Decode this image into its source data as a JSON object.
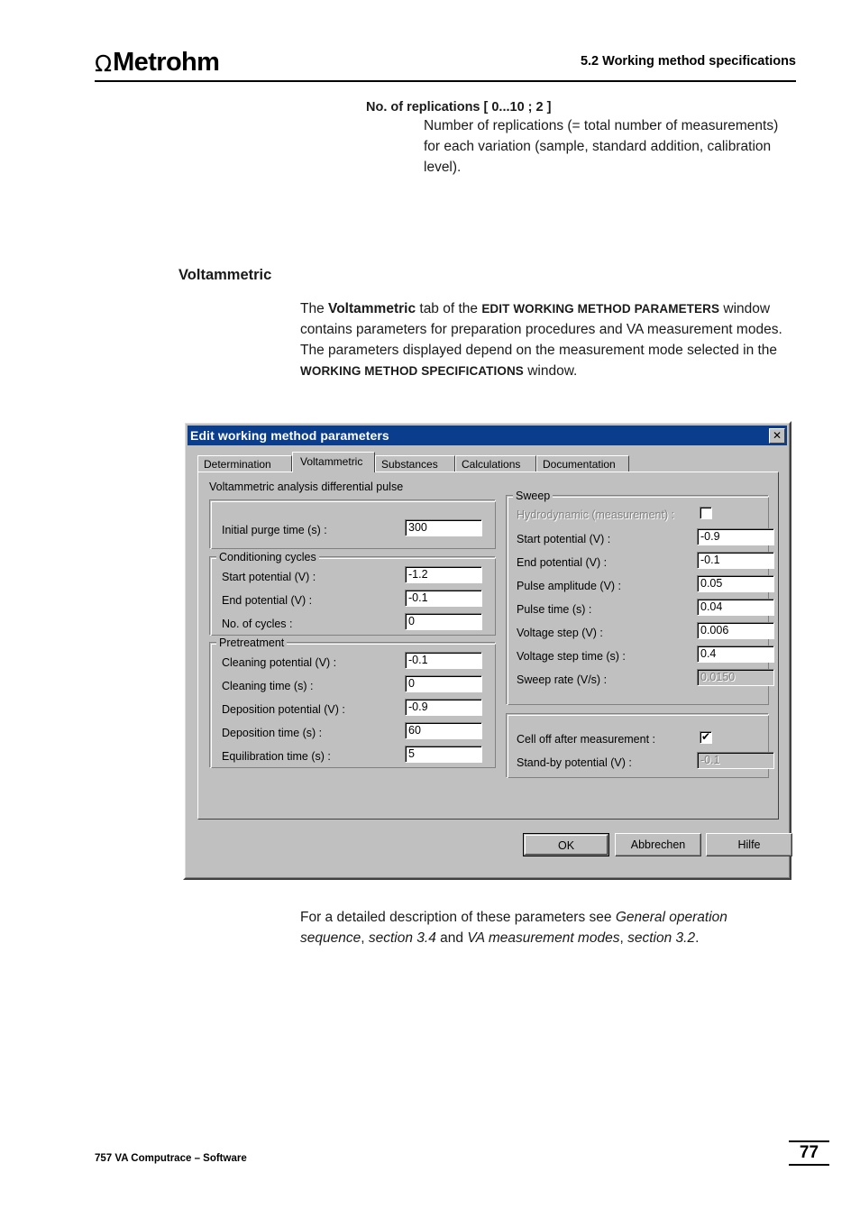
{
  "header": {
    "logo_symbol": "Ω",
    "logo_text": "Metrohm",
    "section_title": "5.2  Working method specifications"
  },
  "content": {
    "replications_term": "No. of replications   [ 0...10 ; 2 ]",
    "replications_desc": "Number of replications (= total number of measurements) for each variation (sample, standard addition, calibration level).",
    "section_heading": "Voltammetric",
    "voltammetric_desc_parts": {
      "p1": "The ",
      "b1": "Voltammetric",
      "p2": " tab of the ",
      "b2": "EDIT WORKING METHOD PARAMETERS",
      "p3": " window contains parameters for preparation procedures and VA measurement modes. The parameters displayed depend on the measurement mode selected in the ",
      "b3": "WORKING METHOD SPECIFICATIONS",
      "p4": " window."
    },
    "footer_note_parts": {
      "p1": "For a detailed description of these parameters see ",
      "i1": "General operation sequence",
      "p2": ", ",
      "i2": "section 3.4",
      "p3": " and ",
      "i3": "VA measurement modes",
      "p4": ", ",
      "i4": "section 3.2",
      "p5": "."
    }
  },
  "dialog": {
    "title": "Edit working method parameters",
    "close_label": "✕",
    "tabs": [
      {
        "label": "Determination",
        "active": false
      },
      {
        "label": "Voltammetric",
        "active": true
      },
      {
        "label": "Substances",
        "active": false
      },
      {
        "label": "Calculations",
        "active": false
      },
      {
        "label": "Documentation",
        "active": false
      }
    ],
    "mode_label": "Voltammetric analysis differential pulse",
    "purge_group": {
      "label": "Initial purge time (s) :",
      "value": "300"
    },
    "conditioning": {
      "title": "Conditioning cycles",
      "rows": [
        {
          "label": "Start potential (V) :",
          "value": "-1.2"
        },
        {
          "label": "End potential (V) :",
          "value": "-0.1"
        },
        {
          "label": "No. of cycles :",
          "value": "0"
        }
      ]
    },
    "pretreatment": {
      "title": "Pretreatment",
      "rows": [
        {
          "label": "Cleaning potential (V) :",
          "value": "-0.1"
        },
        {
          "label": "Cleaning time (s) :",
          "value": "0"
        },
        {
          "label": "Deposition potential (V) :",
          "value": "-0.9"
        },
        {
          "label": "Deposition time (s) :",
          "value": "60"
        },
        {
          "label": "Equilibration time (s) :",
          "value": "5"
        }
      ]
    },
    "sweep": {
      "title": "Sweep",
      "hydrodynamic": {
        "label": "Hydrodynamic (measurement) :",
        "checked": false,
        "disabled": true,
        "mark": ""
      },
      "rows": [
        {
          "label": "Start potential (V) :",
          "value": "-0.9",
          "readonly": false
        },
        {
          "label": "End potential (V) :",
          "value": "-0.1",
          "readonly": false
        },
        {
          "label": "Pulse amplitude (V) :",
          "value": "0.05",
          "readonly": false
        },
        {
          "label": "Pulse time (s) :",
          "value": "0.04",
          "readonly": false
        },
        {
          "label": "Voltage step (V) :",
          "value": "0.006",
          "readonly": false
        },
        {
          "label": "Voltage step time (s) :",
          "value": "0.4",
          "readonly": false
        },
        {
          "label": "Sweep rate (V/s) :",
          "value": "0.0150",
          "readonly": true
        }
      ]
    },
    "cell": {
      "checkbox_label": "Cell off after measurement :",
      "checkbox_mark": "✔",
      "standby_label": "Stand-by potential (V) :",
      "standby_value": "-0.1"
    },
    "buttons": {
      "ok": "OK",
      "cancel": "Abbrechen",
      "help": "Hilfe"
    }
  },
  "footer": {
    "product": "757 VA Computrace – Software",
    "page_number": "77"
  }
}
